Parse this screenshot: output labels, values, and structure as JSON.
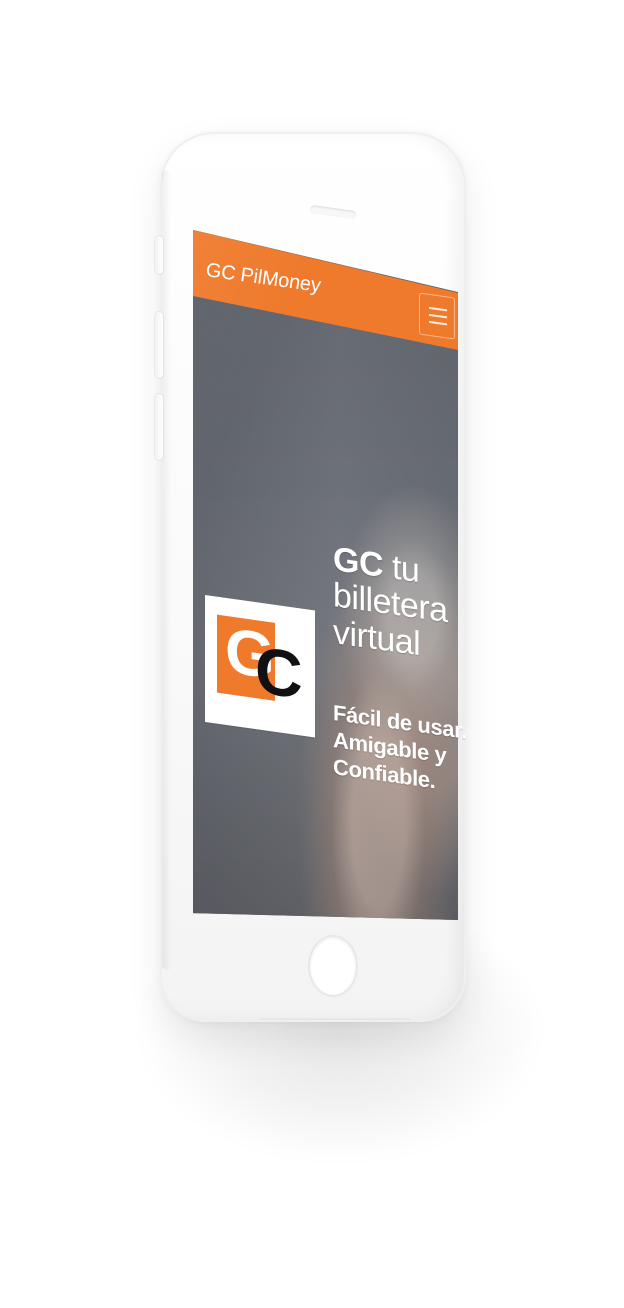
{
  "app": {
    "brand": "GC PilMoney"
  },
  "header": {
    "menu_icon": "hamburger-menu-icon"
  },
  "hero": {
    "logo_text_left": "G",
    "logo_text_right": "C",
    "headline_bold": "GC",
    "headline_line1_rest": " tu",
    "headline_line2": "billetera",
    "headline_line3": "virtual",
    "subtitle_line1": "Fácil de usar.",
    "subtitle_line2": "Amigable y",
    "subtitle_line3": "Confiable."
  },
  "colors": {
    "accent": "#ef7a2c",
    "text_on_dark": "#ffffff",
    "logo_dark": "#111111",
    "device_white": "#ffffff"
  }
}
